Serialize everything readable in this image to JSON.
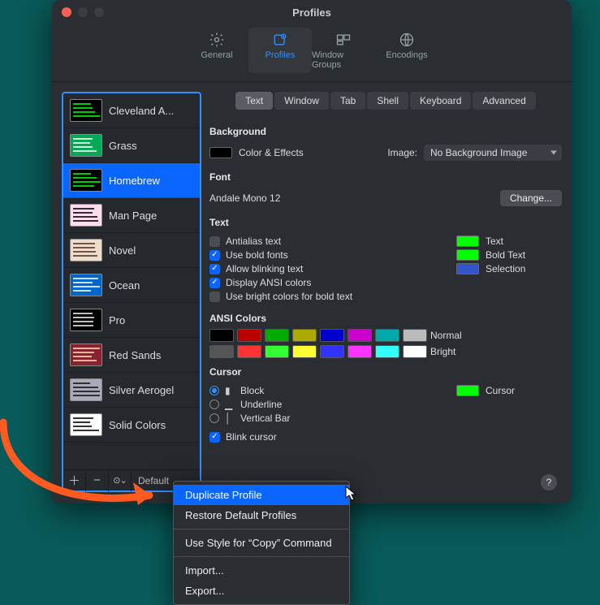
{
  "window": {
    "title": "Profiles"
  },
  "toolbar": {
    "items": [
      {
        "label": "General"
      },
      {
        "label": "Profiles"
      },
      {
        "label": "Window Groups"
      },
      {
        "label": "Encodings"
      }
    ]
  },
  "sidebar": {
    "profiles": [
      {
        "name": "Cleveland A...",
        "bg": "#000",
        "fg": "#0f0"
      },
      {
        "name": "Grass",
        "bg": "#0a5",
        "fg": "#fff"
      },
      {
        "name": "Homebrew",
        "bg": "#000",
        "fg": "#0f0",
        "selected": true
      },
      {
        "name": "Man Page",
        "bg": "#fde",
        "fg": "#000"
      },
      {
        "name": "Novel",
        "bg": "#edc",
        "fg": "#532"
      },
      {
        "name": "Ocean",
        "bg": "#06c",
        "fg": "#fff"
      },
      {
        "name": "Pro",
        "bg": "#000",
        "fg": "#eee"
      },
      {
        "name": "Red Sands",
        "bg": "#823",
        "fg": "#fda"
      },
      {
        "name": "Silver Aerogel",
        "bg": "#aab",
        "fg": "#111"
      },
      {
        "name": "Solid Colors",
        "bg": "#fff",
        "fg": "#000"
      }
    ],
    "footer": {
      "default_label": "Default"
    }
  },
  "tabs": [
    "Text",
    "Window",
    "Tab",
    "Shell",
    "Keyboard",
    "Advanced"
  ],
  "active_tab": "Text",
  "background": {
    "heading": "Background",
    "swatch": "#000000",
    "label": "Color & Effects",
    "image_label": "Image:",
    "image_value": "No Background Image"
  },
  "font": {
    "heading": "Font",
    "value": "Andale Mono 12",
    "change_label": "Change..."
  },
  "text": {
    "heading": "Text",
    "options": [
      {
        "label": "Antialias text",
        "checked": false
      },
      {
        "label": "Use bold fonts",
        "checked": true
      },
      {
        "label": "Allow blinking text",
        "checked": true
      },
      {
        "label": "Display ANSI colors",
        "checked": true
      },
      {
        "label": "Use bright colors for bold text",
        "checked": false
      }
    ],
    "samples": [
      {
        "label": "Text",
        "color": "#00ff00"
      },
      {
        "label": "Bold Text",
        "color": "#00ff00"
      },
      {
        "label": "Selection",
        "color": "#3355cc"
      }
    ]
  },
  "ansi": {
    "heading": "ANSI Colors",
    "rows": [
      {
        "label": "Normal",
        "colors": [
          "#000000",
          "#bb0000",
          "#00aa00",
          "#aaaa00",
          "#0000cc",
          "#cc00cc",
          "#00aaaa",
          "#bbbbbb"
        ]
      },
      {
        "label": "Bright",
        "colors": [
          "#555555",
          "#ff3333",
          "#33ff33",
          "#ffff33",
          "#3333ff",
          "#ff33ff",
          "#33ffff",
          "#ffffff"
        ]
      }
    ]
  },
  "cursor": {
    "heading": "Cursor",
    "shapes": [
      {
        "label": "Block",
        "selected": true
      },
      {
        "label": "Underline",
        "selected": false
      },
      {
        "label": "Vertical Bar",
        "selected": false
      }
    ],
    "blink": {
      "label": "Blink cursor",
      "checked": true
    },
    "sample": {
      "label": "Cursor",
      "color": "#00ff00"
    }
  },
  "context_menu": {
    "items": [
      {
        "label": "Duplicate Profile",
        "selected": true
      },
      {
        "label": "Restore Default Profiles"
      },
      {
        "sep": true
      },
      {
        "label": "Use Style for “Copy” Command"
      },
      {
        "sep": true
      },
      {
        "label": "Import..."
      },
      {
        "label": "Export..."
      }
    ]
  }
}
